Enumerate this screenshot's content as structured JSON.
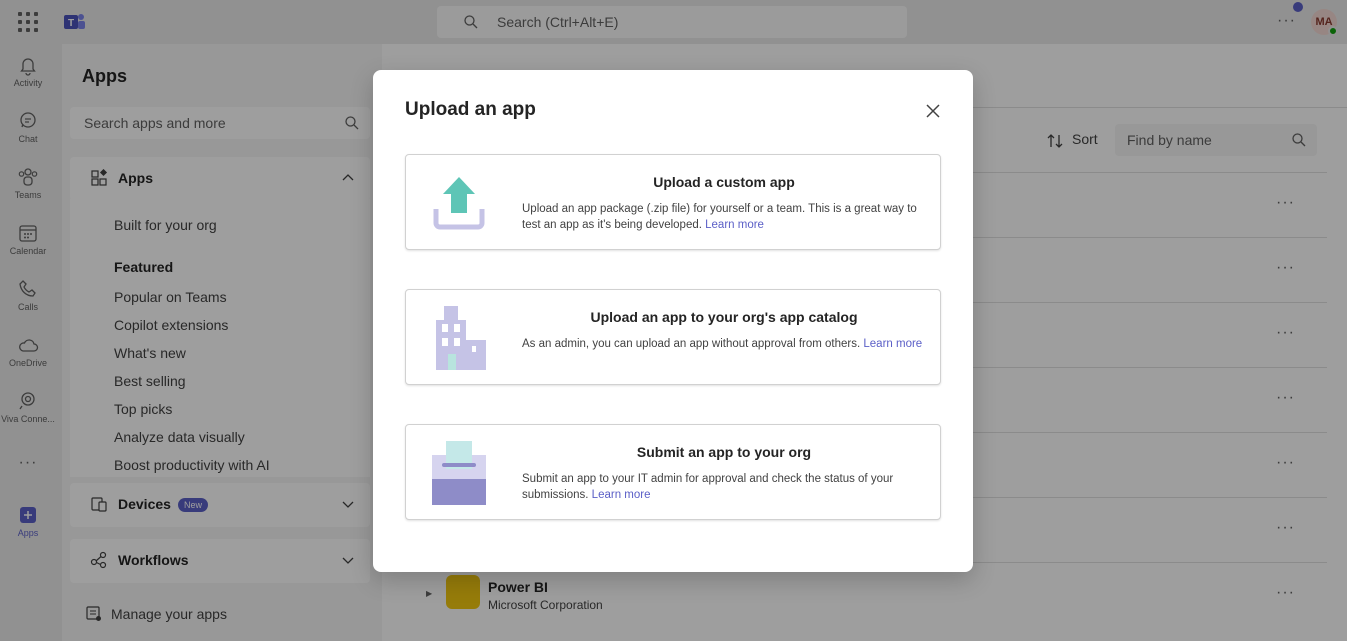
{
  "topbar": {
    "search_placeholder": "Search (Ctrl+Alt+E)",
    "avatar_initials": "MA",
    "more": "···"
  },
  "rail": {
    "items": [
      {
        "label": "Activity",
        "icon": "bell-icon"
      },
      {
        "label": "Chat",
        "icon": "chat-icon"
      },
      {
        "label": "Teams",
        "icon": "teams-icon"
      },
      {
        "label": "Calendar",
        "icon": "calendar-icon"
      },
      {
        "label": "Calls",
        "icon": "phone-icon"
      },
      {
        "label": "OneDrive",
        "icon": "cloud-icon"
      },
      {
        "label": "Viva Conne...",
        "icon": "viva-icon"
      },
      {
        "label": "Apps",
        "icon": "apps-plus-icon"
      }
    ],
    "more": "···"
  },
  "apps_pane": {
    "title": "Apps",
    "search_placeholder": "Search apps and more",
    "apps_section": "Apps",
    "apps_items": [
      "Built for your org",
      "Featured",
      "Popular on Teams",
      "Copilot extensions",
      "What's new",
      "Best selling",
      "Top picks",
      "Analyze data visually",
      "Boost productivity with AI"
    ],
    "devices_section": "Devices",
    "devices_badge": "New",
    "workflows_section": "Workflows",
    "manage": "Manage your apps"
  },
  "main": {
    "sort_label": "Sort",
    "find_placeholder": "Find by name",
    "row_more": "···",
    "visible_app": {
      "name": "Power BI",
      "publisher": "Microsoft Corporation"
    }
  },
  "dialog": {
    "title": "Upload an app",
    "cards": [
      {
        "title": "Upload a custom app",
        "desc": "Upload an app package (.zip file) for yourself or a team. This is a great way to test an app as it's being developed.",
        "link": "Learn more"
      },
      {
        "title": "Upload an app to your org's app catalog",
        "desc": "As an admin, you can upload an app without approval from others.",
        "link": "Learn more"
      },
      {
        "title": "Submit an app to your org",
        "desc": "Submit an app to your IT admin for approval and check the status of your submissions.",
        "link": "Learn more"
      }
    ]
  },
  "colors": {
    "accent": "#5b5fc7",
    "overlay": "rgba(0,0,0,0.38)",
    "illustration_teal": "#5ec5b6",
    "illustration_lavender": "#c5c3e6"
  }
}
